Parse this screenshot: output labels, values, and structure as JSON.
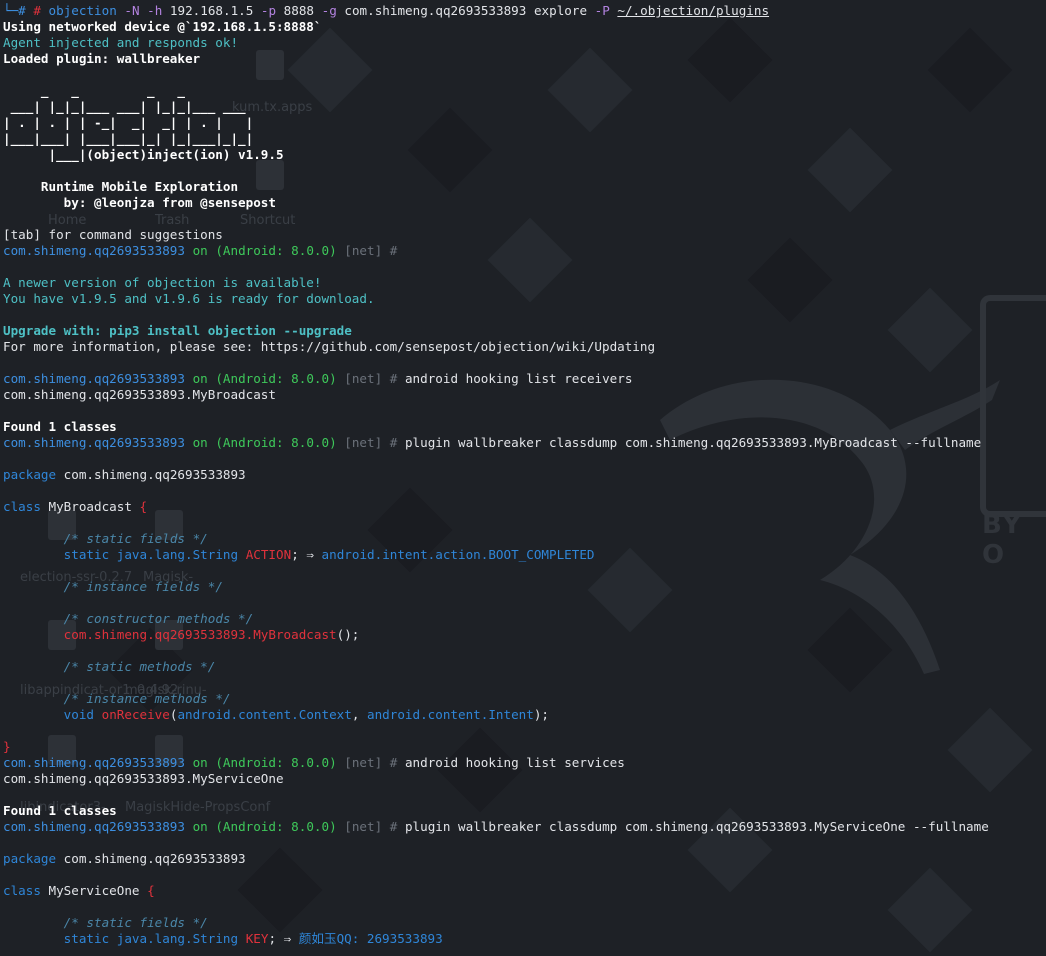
{
  "prompt": {
    "prefix": "└─# ",
    "cmd": "objection",
    "flag_n": "-N",
    "flag_h": "-h",
    "host": "192.168.1.5",
    "flag_p": "-p",
    "port": "8888",
    "flag_g": "-g",
    "package_arg": "com.shimeng.qq2693533893",
    "subcmd": "explore",
    "flag_P": "-P",
    "plugins_path": "~/.objection/plugins"
  },
  "intro": {
    "networked": "Using networked device @`192.168.1.5:8888`",
    "agent_ok": "Agent injected and responds ok!",
    "loaded_plugin": "Loaded plugin: wallbreaker",
    "banner": [
      "     _   _         _   _",
      " ___| |_|_|___ ___| |_|_|___ ___",
      "| . | . | | -_|  _|  _| | . |   |",
      "|___|___| |___|___|_| |_|___|_|_|",
      "      |___|(object)inject(ion) v1.9.5"
    ],
    "runtime": "     Runtime Mobile Exploration",
    "byline": "        by: @leonjza from @sensepost",
    "tab_hint": "[tab] for command suggestions"
  },
  "session": {
    "app": "com.shimeng.qq2693533893",
    "on": "on",
    "device": "(Android: 8.0.0)",
    "net": "[net]",
    "hash": "#"
  },
  "update": {
    "newer": "A newer version of objection is available!",
    "versions": "You have v1.9.5 and v1.9.6 is ready for download.",
    "upgrade": "Upgrade with: pip3 install objection --upgrade",
    "more_info": "For more information, please see: https://github.com/sensepost/objection/wiki/Updating"
  },
  "receivers": {
    "command": "android hooking list receivers",
    "result": "com.shimeng.qq2693533893.MyBroadcast",
    "found": "Found 1 classes",
    "dump_command": "plugin wallbreaker classdump com.shimeng.qq2693533893.MyBroadcast --fullname",
    "package_kw": "package",
    "package_name": "com.shimeng.qq2693533893",
    "class_kw": "class",
    "class_name": "MyBroadcast",
    "open_brace": "{",
    "static_fields_cmt": "/* static fields */",
    "static_kw": "static",
    "field_type": "java.lang.String",
    "field_name": "ACTION",
    "field_arrow": "; ⇒",
    "field_value": "android.intent.action.BOOT_COMPLETED",
    "instance_fields_cmt": "/* instance fields */",
    "constructor_cmt": "/* constructor methods */",
    "constructor_name": "com.shimeng.qq2693533893.MyBroadcast",
    "constructor_tail": "();",
    "static_methods_cmt": "/* static methods */",
    "instance_methods_cmt": "/* instance methods */",
    "void_kw": "void",
    "method_name": "onReceive",
    "method_open": "(",
    "param1": "android.content.Context",
    "param_sep": ", ",
    "param2": "android.content.Intent",
    "method_close": ");",
    "close_brace": "}"
  },
  "services": {
    "command": "android hooking list services",
    "result": "com.shimeng.qq2693533893.MyServiceOne",
    "found": "Found 1 classes",
    "dump_command": "plugin wallbreaker classdump com.shimeng.qq2693533893.MyServiceOne --fullname",
    "package_kw": "package",
    "package_name": "com.shimeng.qq2693533893",
    "class_kw": "class",
    "class_name": "MyServiceOne",
    "open_brace": "{",
    "static_fields_cmt": "/* static fields */",
    "static_kw": "static",
    "field_type": "java.lang.String",
    "field_name": "KEY",
    "field_arrow": "; ⇒",
    "field_value": "颜如玉QQ: 2693533893"
  },
  "desktop_ghost": [
    "kum.tx.apps",
    "Home",
    "Trash",
    "Shortcut",
    "election-ssr-0.2.7",
    "Magisk-",
    "libappindicat-or1_0.4.92",
    "magisk-rinu-",
    "libindicator3-",
    "MagiskHide-PropsConf"
  ],
  "colors": {
    "background": "#1e2126",
    "prompt_blue": "#3d8fe0",
    "device_green": "#3ec85a",
    "error_red": "#e0323c",
    "flag_purple": "#b383e0",
    "notice_teal": "#4ec0c5"
  }
}
